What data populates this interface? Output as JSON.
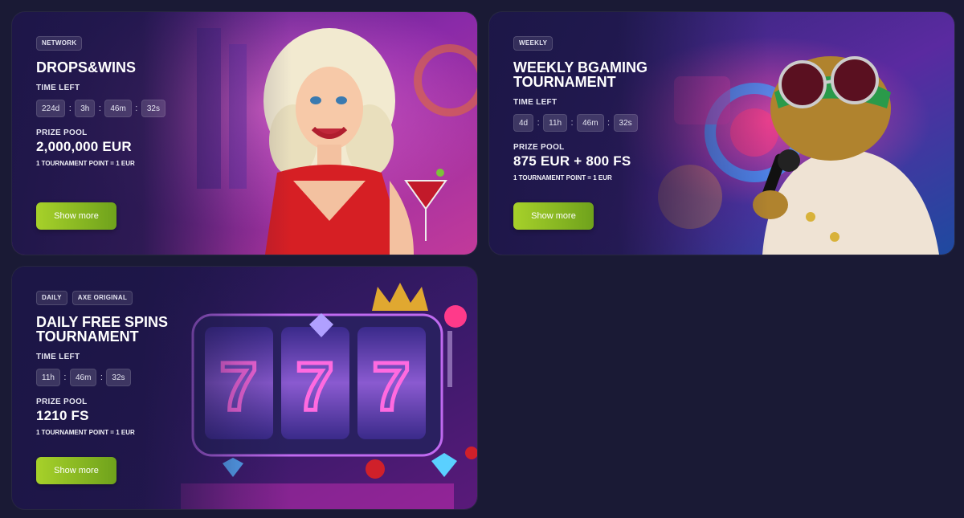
{
  "cards": [
    {
      "tags": [
        "NETWORK"
      ],
      "title": "DROPS&WINS",
      "time_label": "TIME LEFT",
      "timer": [
        "224d",
        "3h",
        "46m",
        "32s"
      ],
      "pool_label": "PRIZE POOL",
      "pool_value": "2,000,000 EUR",
      "point_note": "1 TOURNAMENT POINT = 1 EUR",
      "button": "Show more"
    },
    {
      "tags": [
        "WEEKLY"
      ],
      "title": "WEEKLY BGAMING TOURNAMENT",
      "time_label": "TIME LEFT",
      "timer": [
        "4d",
        "11h",
        "46m",
        "32s"
      ],
      "pool_label": "PRIZE POOL",
      "pool_value": "875 EUR + 800 FS",
      "point_note": "1 TOURNAMENT POINT = 1 EUR",
      "button": "Show more"
    },
    {
      "tags": [
        "DAILY",
        "AXE ORIGINAL"
      ],
      "title": "DAILY FREE SPINS TOURNAMENT",
      "time_label": "TIME LEFT",
      "timer": [
        "11h",
        "46m",
        "32s"
      ],
      "pool_label": "PRIZE POOL",
      "pool_value": "1210 FS",
      "point_note": "1 TOURNAMENT POINT = 1 EUR",
      "button": "Show more"
    }
  ],
  "colors": {
    "page_bg": "#1a1a35",
    "button_start": "#a7d12a",
    "button_end": "#6fa21c"
  }
}
